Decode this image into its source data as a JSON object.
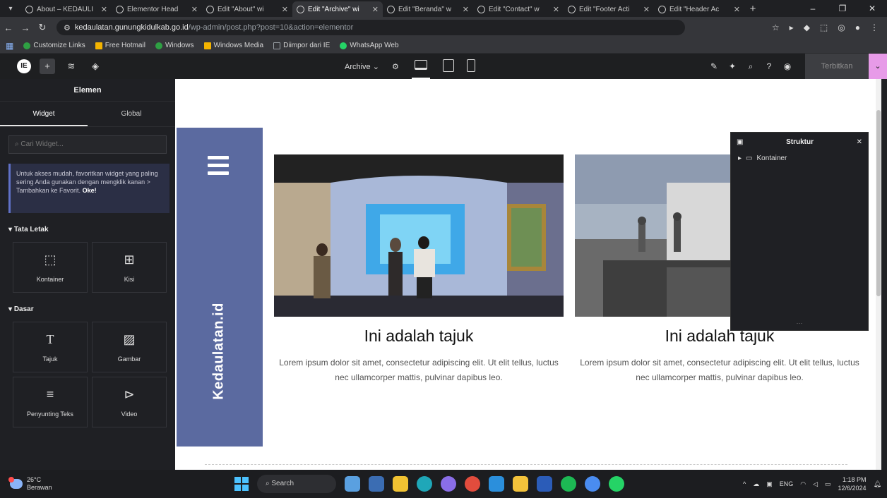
{
  "browser": {
    "tabs": [
      {
        "title": "About – KEDAULI"
      },
      {
        "title": "Elementor Head"
      },
      {
        "title": "Edit \"About\" wi"
      },
      {
        "title": "Edit \"Archive\" wi"
      },
      {
        "title": "Edit \"Beranda\" w"
      },
      {
        "title": "Edit \"Contact\" w"
      },
      {
        "title": "Edit \"Footer Acti"
      },
      {
        "title": "Edit \"Header Ac"
      }
    ],
    "active_tab_index": 3,
    "url_host": "kedaulatan.gunungkidulkab.go.id",
    "url_path": "/wp-admin/post.php?post=10&action=elementor",
    "bookmarks": [
      {
        "label": "Customize Links",
        "color": "#2ea043"
      },
      {
        "label": "Free Hotmail",
        "color": "#f4b400"
      },
      {
        "label": "Windows",
        "color": "#2ea043"
      },
      {
        "label": "Windows Media",
        "color": "#f4b400"
      },
      {
        "label": "Diimpor dari IE",
        "color": "#9aa0a6"
      },
      {
        "label": "WhatsApp Web",
        "color": "#25d366"
      }
    ]
  },
  "elementor": {
    "template_name": "Archive",
    "publish_label": "Terbitkan",
    "panel": {
      "title": "Elemen",
      "tab_widget": "Widget",
      "tab_global": "Global",
      "search_placeholder": "Cari Widget...",
      "notice_text": "Untuk akses mudah, favoritkan widget yang paling sering Anda gunakan dengan mengklik kanan > Tambahkan ke Favorit.",
      "notice_link": "Oke!",
      "section_layout": "Tata Letak",
      "section_basic": "Dasar",
      "layout_widgets": [
        {
          "label": "Kontainer",
          "icon": "container-icon"
        },
        {
          "label": "Kisi",
          "icon": "grid-icon"
        }
      ],
      "basic_widgets": [
        {
          "label": "Tajuk",
          "icon": "heading-icon"
        },
        {
          "label": "Gambar",
          "icon": "image-icon"
        },
        {
          "label": "Penyunting Teks",
          "icon": "text-editor-icon"
        },
        {
          "label": "Video",
          "icon": "video-icon"
        }
      ]
    },
    "canvas": {
      "site_title_vertical": "Kedaulatan.id",
      "posts": [
        {
          "heading": "Ini adalah tajuk",
          "excerpt": "Lorem ipsum dolor sit amet, consectetur adipiscing elit. Ut elit tellus, luctus nec ullamcorper mattis, pulvinar dapibus leo."
        },
        {
          "heading": "Ini adalah tajuk",
          "excerpt": "Lorem ipsum dolor sit amet, consectetur adipiscing elit. Ut elit tellus, luctus nec ullamcorper mattis, pulvinar dapibus leo."
        }
      ]
    },
    "structure": {
      "title": "Struktur",
      "items": [
        {
          "label": "Kontainer"
        }
      ]
    }
  },
  "taskbar": {
    "weather_temp": "26°C",
    "weather_desc": "Berawan",
    "search_label": "Search",
    "lang": "ENG",
    "time": "1:18 PM",
    "date": "12/6/2024"
  }
}
